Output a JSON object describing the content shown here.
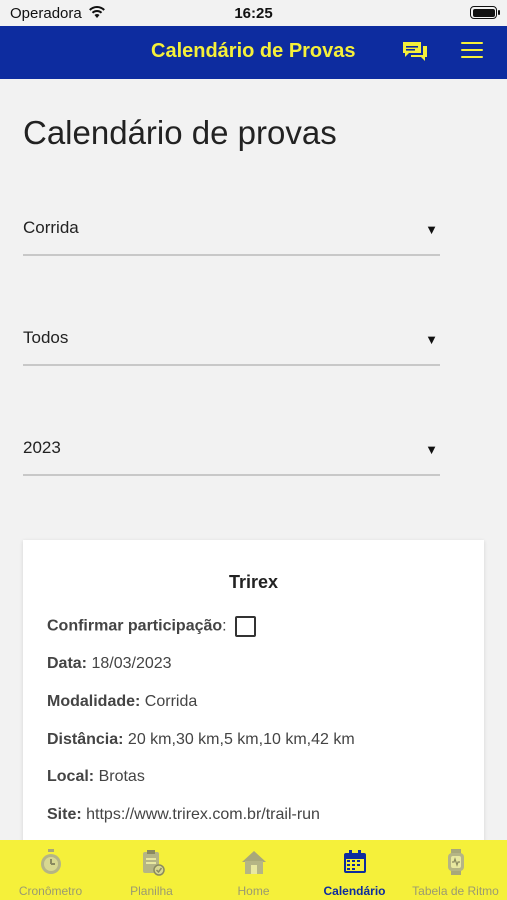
{
  "status_bar": {
    "carrier": "Operadora",
    "time": "16:25"
  },
  "app_bar": {
    "title": "Calendário de Provas",
    "chat_icon": "chat-icon",
    "menu_icon": "hamburger-menu-icon"
  },
  "page": {
    "title": "Calendário de provas"
  },
  "filters": [
    {
      "value": "Corrida"
    },
    {
      "value": "Todos"
    },
    {
      "value": "2023"
    }
  ],
  "arrow_glyph": "▼",
  "event": {
    "name": "Trirex",
    "confirm_label": "Confirmar participação",
    "confirm_suffix": ":",
    "date_label": "Data:",
    "date_value": "18/03/2023",
    "mode_label": "Modalidade:",
    "mode_value": "Corrida",
    "distance_label": "Distância:",
    "distance_value": "20 km,30 km,5 km,10 km,42 km",
    "place_label": "Local:",
    "place_value": "Brotas",
    "site_label": "Site:",
    "site_value": "https://www.trirex.com.br/trail-run"
  },
  "tabs": [
    {
      "label": "Cronômetro",
      "icon": "stopwatch-icon",
      "active": false
    },
    {
      "label": "Planilha",
      "icon": "clipboard-icon",
      "active": false
    },
    {
      "label": "Home",
      "icon": "home-icon",
      "active": false
    },
    {
      "label": "Calendário",
      "icon": "calendar-icon",
      "active": true
    },
    {
      "label": "Tabela de Ritmo",
      "icon": "smartwatch-icon",
      "active": false
    }
  ],
  "colors": {
    "brand_blue": "#0d2c9f",
    "brand_yellow": "#f5f03a"
  }
}
